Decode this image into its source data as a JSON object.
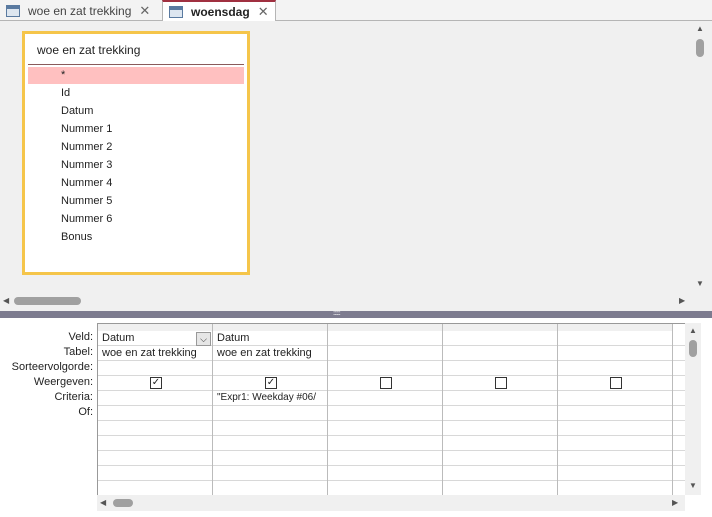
{
  "tabs": [
    {
      "label": "woe en zat trekking",
      "active": false
    },
    {
      "label": "woensdag",
      "active": true
    }
  ],
  "table": {
    "title": "woe en zat trekking",
    "fields": [
      "*",
      "Id",
      "Datum",
      "Nummer 1",
      "Nummer 2",
      "Nummer 3",
      "Nummer 4",
      "Nummer 5",
      "Nummer 6",
      "Bonus"
    ]
  },
  "grid": {
    "row_labels": [
      "Veld:",
      "Tabel:",
      "Sorteervolgorde:",
      "Weergeven:",
      "Criteria:",
      "Of:"
    ],
    "columns": [
      {
        "veld": "Datum",
        "tabel": "woe en zat trekking",
        "weergeven": true,
        "criteria": ""
      },
      {
        "veld": "Datum",
        "tabel": "woe en zat trekking",
        "weergeven": true,
        "criteria": "\"Expr1: Weekday #06/"
      },
      {
        "veld": "",
        "tabel": "",
        "weergeven": false,
        "criteria": ""
      },
      {
        "veld": "",
        "tabel": "",
        "weergeven": false,
        "criteria": ""
      },
      {
        "veld": "",
        "tabel": "",
        "weergeven": false,
        "criteria": ""
      }
    ]
  },
  "splitter_grip": "::::::::::",
  "colors": {
    "table_border": "#f5c54a",
    "selected_field": "#ffc0c0",
    "splitter": "#7d7b8f"
  }
}
